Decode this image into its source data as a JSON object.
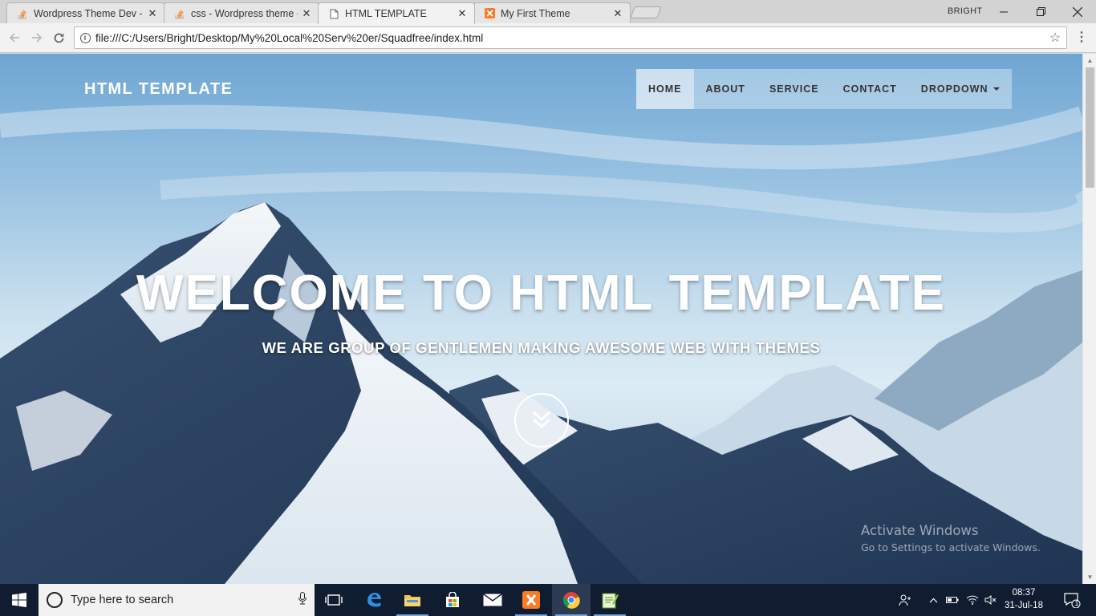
{
  "browser": {
    "tabs": [
      {
        "title": "Wordpress Theme Dev - ",
        "favicon": "stackoverflow-icon",
        "active": false
      },
      {
        "title": "css - Wordpress theme - ",
        "favicon": "stackoverflow-icon",
        "active": false
      },
      {
        "title": "HTML TEMPLATE",
        "favicon": "page-icon",
        "active": true
      },
      {
        "title": "My First Theme",
        "favicon": "xampp-icon",
        "active": false
      }
    ],
    "profile_name": "BRIGHT",
    "url": "file:///C:/Users/Bright/Desktop/My%20Local%20Serv%20er/Squadfree/index.html"
  },
  "page": {
    "brand": "HTML TEMPLATE",
    "nav": [
      {
        "label": "HOME",
        "active": true
      },
      {
        "label": "ABOUT",
        "active": false
      },
      {
        "label": "SERVICE",
        "active": false
      },
      {
        "label": "CONTACT",
        "active": false
      },
      {
        "label": "DROPDOWN",
        "active": false,
        "has_caret": true
      }
    ],
    "hero_title": "WELCOME TO HTML TEMPLATE",
    "hero_subtitle": "WE ARE GROUP OF GENTLEMEN MAKING AWESOME WEB WITH THEMES",
    "watermark_line1": "Activate Windows",
    "watermark_line2": "Go to Settings to activate Windows."
  },
  "taskbar": {
    "search_placeholder": "Type here to search",
    "apps": [
      "task-view-icon",
      "edge-icon",
      "file-explorer-icon",
      "store-icon",
      "mail-icon",
      "xampp-icon",
      "chrome-icon",
      "notepad-plus-plus-icon"
    ],
    "time": "08:37",
    "date": "31-Jul-18",
    "notification_count": "1"
  },
  "colors": {
    "taskbar": "#101c30",
    "sky_top": "#6ea6d3",
    "nav_text": "#333333"
  }
}
